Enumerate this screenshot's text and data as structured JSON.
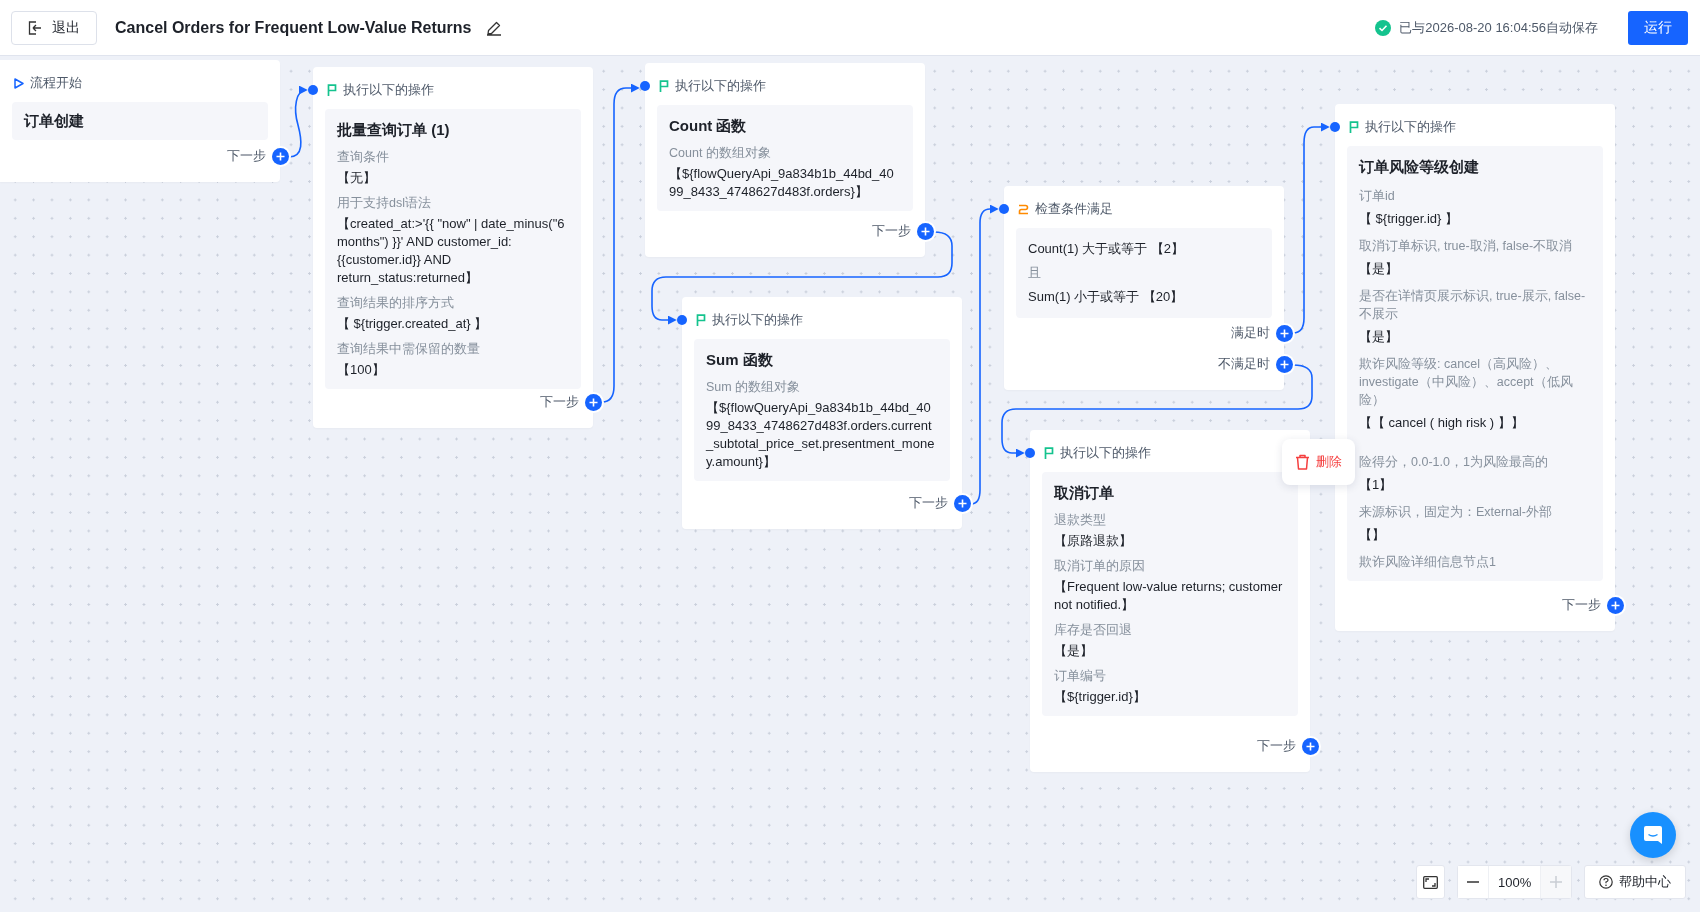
{
  "header": {
    "exit_button": "退出",
    "title": "Cancel Orders for Frequent Low-Value Returns",
    "save_status": "已与2026-08-20 16:04:56自动保存",
    "run_button": "运行"
  },
  "nodes": [
    {
      "kind": "start",
      "header": "流程开始",
      "title": "订单创建",
      "outputs": [
        "下一步"
      ]
    },
    {
      "kind": "action",
      "header": "执行以下的操作",
      "title": "批量查询订单 (1)",
      "fields": [
        {
          "label": "查询条件",
          "value": "【无】"
        },
        {
          "label": "用于支持dsl语法",
          "value": "【created_at:>'{{ \"now\" | date_minus(\"6 months\") }}' AND customer_id:{{customer.id}} AND return_status:returned】"
        },
        {
          "label": "查询结果的排序方式",
          "value": "【 ${trigger.created_at} 】"
        },
        {
          "label": "查询结果中需保留的数量",
          "value": "【100】"
        }
      ],
      "outputs": [
        "下一步"
      ]
    },
    {
      "kind": "action",
      "header": "执行以下的操作",
      "title": "Count 函数",
      "fields": [
        {
          "label": "Count 的数组对象",
          "value": "【${flowQueryApi_9a834b1b_44bd_4099_8433_4748627d483f.orders}】"
        }
      ],
      "outputs": [
        "下一步"
      ]
    },
    {
      "kind": "action",
      "header": "执行以下的操作",
      "title": "Sum 函数",
      "fields": [
        {
          "label": "Sum 的数组对象",
          "value": "【${flowQueryApi_9a834b1b_44bd_4099_8433_4748627d483f.orders.current_subtotal_price_set.presentment_money.amount}】"
        }
      ],
      "outputs": [
        "下一步"
      ]
    },
    {
      "kind": "condition",
      "header": "检查条件满足",
      "lines": [
        {
          "kind": "rule",
          "text": "Count(1) 大于或等于 【2】"
        },
        {
          "kind": "joiner",
          "text": "且"
        },
        {
          "kind": "rule",
          "text": "Sum(1) 小于或等于 【20】"
        }
      ],
      "outputs": [
        "满足时",
        "不满足时"
      ]
    },
    {
      "kind": "action",
      "header": "执行以下的操作",
      "title": "取消订单",
      "fields": [
        {
          "label": "退款类型",
          "value": "【原路退款】"
        },
        {
          "label": "取消订单的原因",
          "value": "【Frequent low-value returns; customer not notified.】"
        },
        {
          "label": "库存是否回退",
          "value": "【是】"
        },
        {
          "label": "订单编号",
          "value": "【${trigger.id}】"
        }
      ],
      "outputs": [
        "下一步"
      ]
    },
    {
      "kind": "action",
      "header": "执行以下的操作",
      "title": "订单风险等级创建",
      "fields": [
        {
          "label": "订单id",
          "value": "【 ${trigger.id} 】"
        },
        {
          "label": "取消订单标识, true-取消, false-不取消",
          "value": "【是】"
        },
        {
          "label": "是否在详情页展示标识, true-展示, false-不展示",
          "value": "【是】"
        },
        {
          "label": "欺诈风险等级: cancel（高风险）、investigate（中风险）、accept（低风险）",
          "value": "【【 cancel ( high risk ) 】】"
        },
        {
          "kind": "covered",
          "label": "险得分，0.0-1.0，1为风险最高的",
          "value": "【1】"
        },
        {
          "label": "来源标识，固定为：External-外部",
          "value": "【】"
        },
        {
          "label": "欺诈风险详细信息节点1"
        }
      ],
      "outputs": [
        "下一步"
      ]
    }
  ],
  "delete_popover": {
    "label": "删除"
  },
  "zoom_controls": {
    "zoom_level": "100%",
    "zoom_in_disabled": true
  },
  "help_button": "帮助中心"
}
